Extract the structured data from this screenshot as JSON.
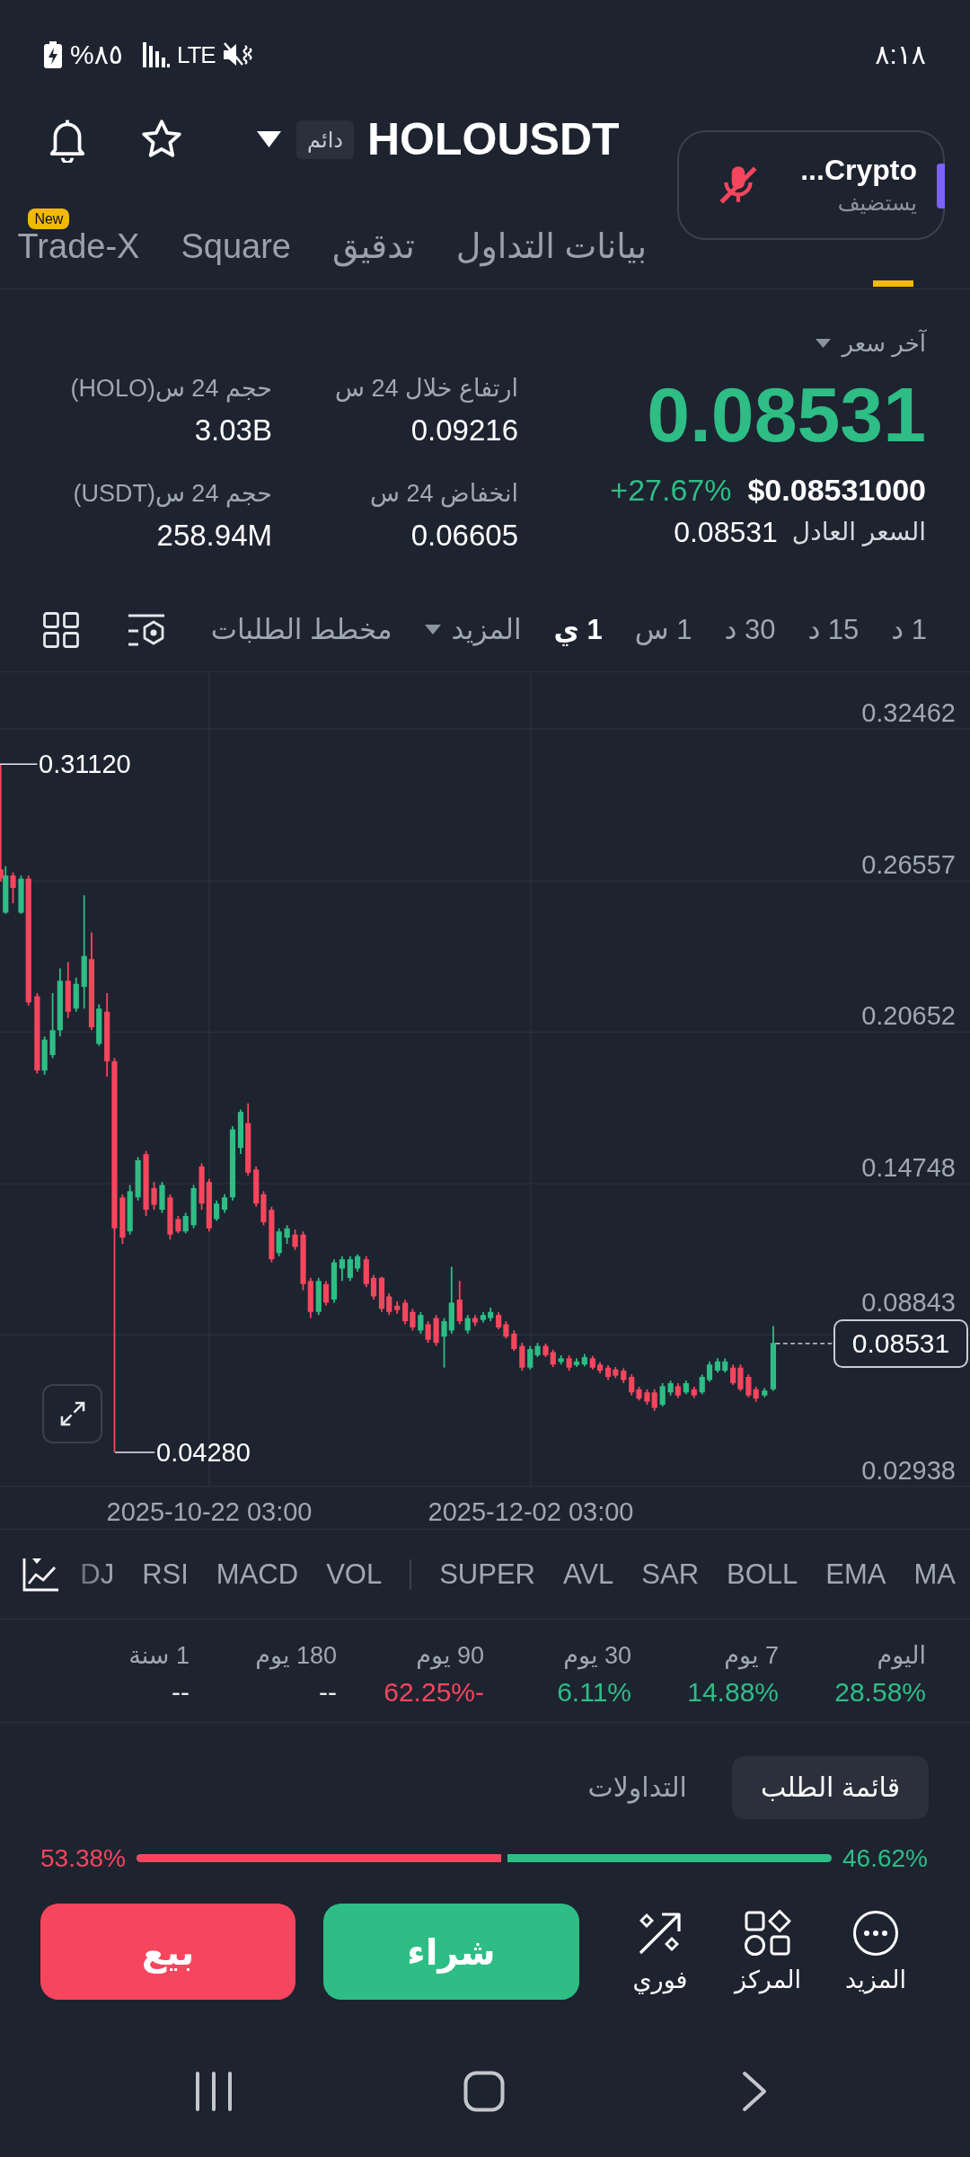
{
  "status_bar": {
    "battery": "٨٥%",
    "network": "LTE",
    "time": "٨:١٨"
  },
  "header": {
    "badge": "دائم",
    "symbol": "HOLOUSDT"
  },
  "call_popup": {
    "title": "Crypto...",
    "subtitle": "يستضيف"
  },
  "tabs": [
    {
      "selected": true
    },
    {
      "label": "بيانات التداول",
      "selected": false
    },
    {
      "label": "تدقيق",
      "selected": false
    },
    {
      "label": "Square",
      "selected": false
    },
    {
      "label": "Trade-X",
      "selected": false,
      "badge": "New"
    }
  ],
  "price": {
    "label": "آخر سعر",
    "last": "0.08531",
    "usd": "$0.08531000",
    "change": "+27.67%",
    "fair_label": "السعر العادل",
    "fair_value": "0.08531"
  },
  "stats": [
    {
      "label": "ارتفاع خلال 24 س",
      "value": "0.09216"
    },
    {
      "label": "حجم 24 س(HOLO)",
      "value": "3.03B"
    },
    {
      "label": "انخفاض 24 س",
      "value": "0.06605"
    },
    {
      "label": "حجم 24 س(USDT)",
      "value": "258.94M"
    }
  ],
  "intervals": [
    {
      "label": "1 د",
      "selected": false
    },
    {
      "label": "15 د",
      "selected": false
    },
    {
      "label": "30 د",
      "selected": false
    },
    {
      "label": "1 س",
      "selected": false
    },
    {
      "label": "1 ي",
      "selected": true
    }
  ],
  "more_menu": "المزيد",
  "depth_chart": "مخطط الطلبات",
  "chart": {
    "price_scale": [
      "0.32462",
      "0.26557",
      "0.20652",
      "0.14748",
      "0.08843",
      "0.02938"
    ],
    "time_scale": [
      "2025-12-02 03:00",
      "2025-10-22 03:00"
    ],
    "high_marker": "0.31120",
    "low_marker": "0.04280",
    "last_price": "0.08531"
  },
  "indicators": {
    "main": [
      "MA",
      "EMA",
      "BOLL",
      "SAR",
      "AVL",
      "SUPER"
    ],
    "sub": [
      "VOL",
      "MACD",
      "RSI",
      "DJ"
    ]
  },
  "performance": [
    {
      "period": "اليوم",
      "change": "28.58%",
      "color": "#2ebd85"
    },
    {
      "period": "7 يوم",
      "change": "14.88%",
      "color": "#2ebd85"
    },
    {
      "period": "30 يوم",
      "change": "6.11%",
      "color": "#2ebd85"
    },
    {
      "period": "90 يوم",
      "change": "-62.25%",
      "color": "#f6465d"
    },
    {
      "period": "180 يوم",
      "change": "--",
      "color": "#eaecef"
    },
    {
      "period": "1 سنة",
      "change": "--",
      "color": "#eaecef"
    }
  ],
  "book_tabs": [
    {
      "label": "قائمة الطلب",
      "selected": true
    },
    {
      "label": "التداولات",
      "selected": false
    }
  ],
  "order_balance": {
    "buy": {
      "share": "46.62%"
    },
    "sell": {
      "share": "53.38%",
      "level": 0.5338
    }
  },
  "actions": [
    {
      "kind": "more",
      "label": "المزيد"
    },
    {
      "kind": "position",
      "label": "المركز"
    },
    {
      "kind": "convert",
      "label": "فوري"
    }
  ],
  "buy_button": "شراء",
  "sell_button": "بيع"
}
